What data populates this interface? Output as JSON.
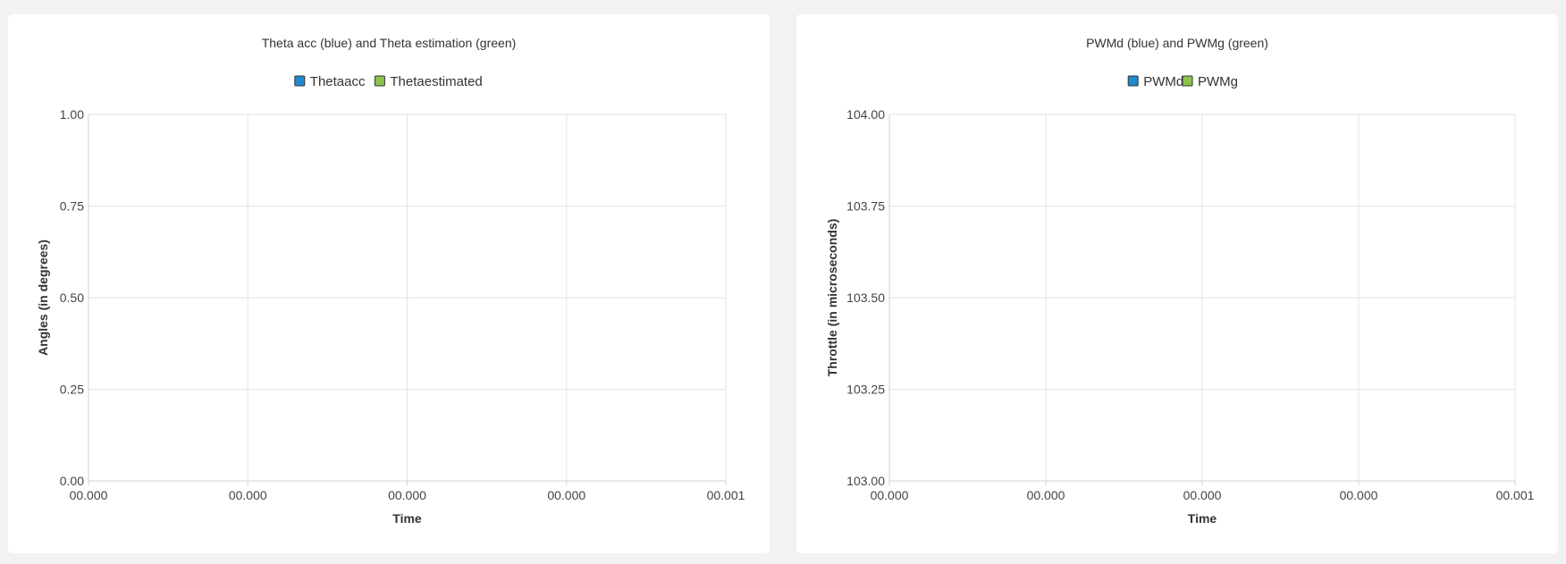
{
  "chart_data": [
    {
      "type": "line",
      "title": "Theta acc (blue) and Theta estimation (green)",
      "xlabel": "Time",
      "ylabel": "Angles (in degrees)",
      "ylim": [
        0,
        1
      ],
      "y_ticks": [
        "1.00",
        "0.75",
        "0.50",
        "0.25",
        "0.00"
      ],
      "x_ticks": [
        "00.000",
        "00.000",
        "00.000",
        "00.000",
        "00.001"
      ],
      "grid": true,
      "legend_position": "top-center",
      "series": [
        {
          "name": "Thetaacc",
          "color": "#1f8ad0",
          "values": []
        },
        {
          "name": "Thetaestimated",
          "color": "#8bc34a",
          "values": []
        }
      ]
    },
    {
      "type": "line",
      "title": "PWMd (blue) and PWMg (green)",
      "xlabel": "Time",
      "ylabel": "Throttle (in microseconds)",
      "ylim": [
        103,
        104
      ],
      "y_ticks": [
        "104.00",
        "103.75",
        "103.50",
        "103.25",
        "103.00"
      ],
      "x_ticks": [
        "00.000",
        "00.000",
        "00.000",
        "00.000",
        "00.001"
      ],
      "grid": true,
      "legend_position": "top-center",
      "series": [
        {
          "name": "PWMd",
          "color": "#1f8ad0",
          "values": []
        },
        {
          "name": "PWMg",
          "color": "#8bc34a",
          "values": []
        }
      ]
    }
  ]
}
